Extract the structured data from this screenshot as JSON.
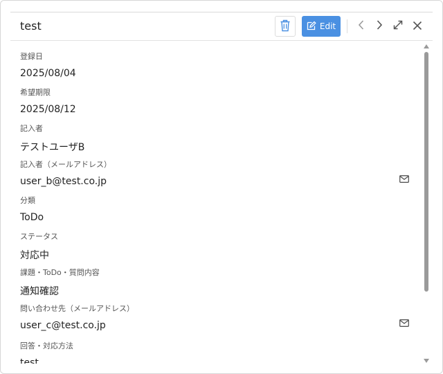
{
  "header": {
    "title": "test",
    "edit_label": "Edit"
  },
  "icons": {
    "delete": "trash-icon",
    "edit": "pencil-icon",
    "prev": "chevron-left-icon",
    "next": "chevron-right-icon",
    "expand": "expand-icon",
    "close": "close-icon",
    "mail": "mail-icon"
  },
  "colors": {
    "accent": "#4a90e2",
    "text": "#222222",
    "label": "#555555"
  },
  "fields": [
    {
      "label": "登録日",
      "value": "2025/08/04"
    },
    {
      "label": "希望期限",
      "value": "2025/08/12"
    },
    {
      "label": "記入者",
      "value": "テストユーザB"
    },
    {
      "label": "記入者（メールアドレス）",
      "value": "user_b@test.co.jp"
    },
    {
      "label": "分類",
      "value": "ToDo"
    },
    {
      "label": "ステータス",
      "value": "対応中"
    },
    {
      "label": "課題・ToDo・質問内容",
      "value": "通知確認"
    },
    {
      "label": "問い合わせ先（メールアドレス）",
      "value": "user_c@test.co.jp"
    },
    {
      "label": "回答・対応方法",
      "value": "test"
    }
  ]
}
